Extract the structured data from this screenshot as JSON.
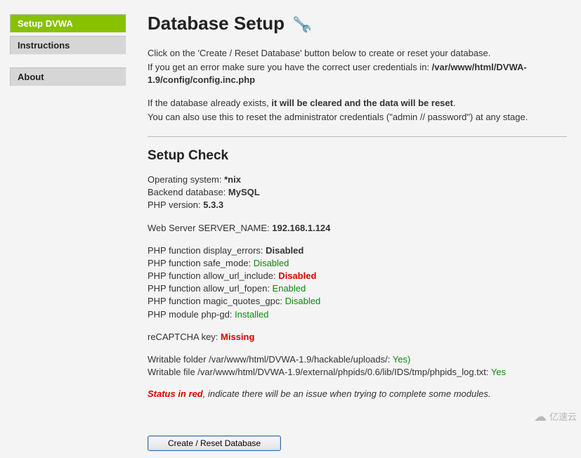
{
  "nav": {
    "setup": "Setup DVWA",
    "instructions": "Instructions",
    "about": "About"
  },
  "header": {
    "title": "Database Setup"
  },
  "intro": {
    "line1_pre": "Click on the 'Create / Reset Database' button below to create or reset your database.",
    "line2_pre": "If you get an error make sure you have the correct user credentials in: ",
    "line2_bold": "/var/www/html/DVWA-1.9/config/config.inc.php",
    "line3_pre": "If the database already exists, ",
    "line3_bold": "it will be cleared and the data will be reset",
    "line3_post": ".",
    "line4": "You can also use this to reset the administrator credentials (\"admin // password\") at any stage."
  },
  "check": {
    "heading": "Setup Check",
    "os_label": "Operating system: ",
    "os_value": "*nix",
    "db_label": "Backend database: ",
    "db_value": "MySQL",
    "php_label": "PHP version: ",
    "php_value": "5.3.3",
    "server_label": "Web Server SERVER_NAME: ",
    "server_value": "192.168.1.124",
    "display_errors_label": "PHP function display_errors: ",
    "display_errors_value": "Disabled",
    "safe_mode_label": "PHP function safe_mode: ",
    "safe_mode_value": "Disabled",
    "allow_url_include_label": "PHP function allow_url_include: ",
    "allow_url_include_value": "Disabled",
    "allow_url_fopen_label": "PHP function allow_url_fopen: ",
    "allow_url_fopen_value": "Enabled",
    "magic_quotes_label": "PHP function magic_quotes_gpc: ",
    "magic_quotes_value": "Disabled",
    "php_gd_label": "PHP module php-gd: ",
    "php_gd_value": "Installed",
    "recaptcha_label": "reCAPTCHA key: ",
    "recaptcha_value": "Missing",
    "writable_folder_label": "Writable folder /var/www/html/DVWA-1.9/hackable/uploads/: ",
    "writable_folder_value": "Yes)",
    "writable_file_label": "Writable file /var/www/html/DVWA-1.9/external/phpids/0.6/lib/IDS/tmp/phpids_log.txt: ",
    "writable_file_value": "Yes",
    "status_red": "Status in red",
    "status_msg": ", indicate there will be an issue when trying to complete some modules."
  },
  "button": {
    "label": "Create / Reset Database"
  },
  "watermark": {
    "text": "亿速云"
  }
}
